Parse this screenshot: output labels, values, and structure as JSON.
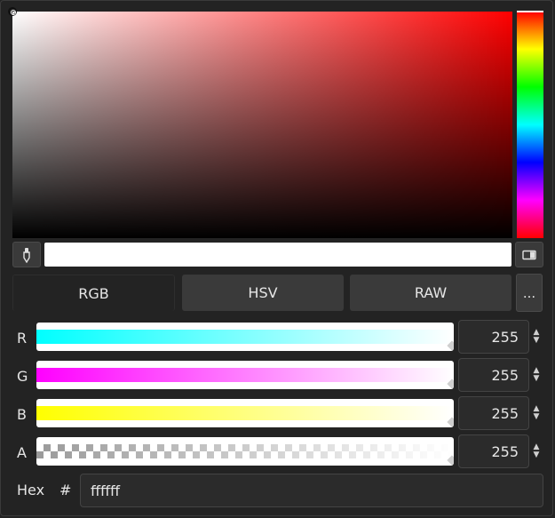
{
  "picker": {
    "hue": 0,
    "saturation": 0,
    "value": 1
  },
  "toolbar": {
    "eyedropper_icon": "eyedropper-icon",
    "sample_icon": "screen-sample-icon"
  },
  "tabs": [
    {
      "label": "RGB",
      "active": true
    },
    {
      "label": "HSV",
      "active": false
    },
    {
      "label": "RAW",
      "active": false
    }
  ],
  "more_label": "...",
  "channels": [
    {
      "label": "R",
      "value": "255",
      "color": "#00ffff"
    },
    {
      "label": "G",
      "value": "255",
      "color": "#ff00ff"
    },
    {
      "label": "B",
      "value": "255",
      "color": "#ffff00"
    },
    {
      "label": "A",
      "value": "255",
      "color": "checker"
    }
  ],
  "hex": {
    "label": "Hex",
    "prefix": "#",
    "value": "ffffff"
  },
  "current_color": "#ffffff"
}
